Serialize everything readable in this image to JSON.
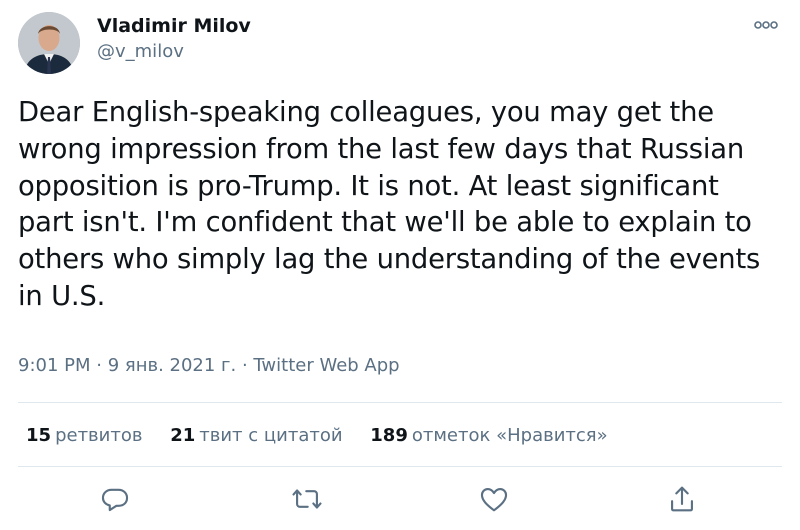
{
  "author": {
    "name": "Vladimir Milov",
    "handle": "@v_milov"
  },
  "tweet": {
    "lines": [
      "Dear English-speaking colleagues, you may get the",
      "wrong impression from the last few days that Russian",
      "opposition is pro-Trump. It is not. At least significant",
      "part isn't. I'm confident that we'll be able to explain to",
      "others who simply lag the understanding of the events",
      "in U.S."
    ]
  },
  "meta": {
    "time": "9:01 PM",
    "date": "9 янв. 2021 г.",
    "source": "Twitter Web App",
    "separator": " · "
  },
  "stats": {
    "retweets": {
      "count": "15",
      "label": "ретвитов"
    },
    "quotes": {
      "count": "21",
      "label": "твит с цитатой"
    },
    "likes": {
      "count": "189",
      "label": "отметок «Нравится»"
    }
  },
  "actions": [
    "reply-icon",
    "retweet-icon",
    "like-icon",
    "share-icon"
  ],
  "colors": {
    "text": "#0f1419",
    "secondary": "#5b7083",
    "divider": "#e1e8ed"
  }
}
